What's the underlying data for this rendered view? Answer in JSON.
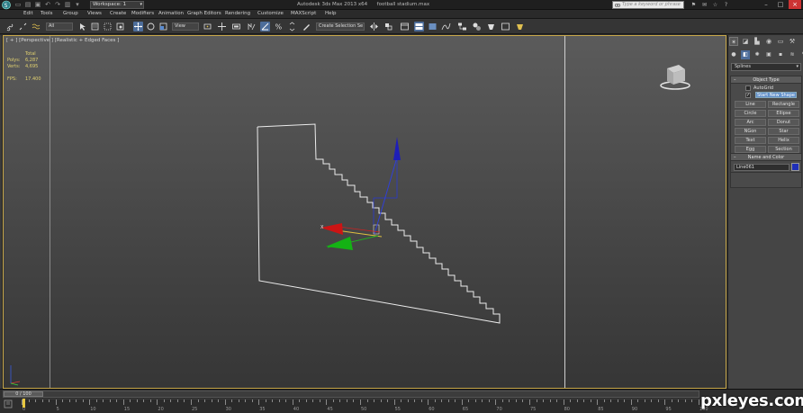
{
  "titlebar": {
    "workspace": "Workspace: 1",
    "title": "Autodesk 3ds Max 2013 x64      football stadium.max",
    "search_placeholder": "Type a keyword or phrase"
  },
  "menu": [
    "Edit",
    "Tools",
    "Group",
    "Views",
    "Create",
    "Modifiers",
    "Animation",
    "Graph Editors",
    "Rendering",
    "Customize",
    "MAXScript",
    "Help"
  ],
  "toolbar": {
    "filter": "All",
    "ref_coord": "View",
    "selection_set": "Create Selection Se"
  },
  "viewport": {
    "label": "[ + ] [Perspective ] [Realistic + Edged Faces ]",
    "stats": {
      "header": "Total",
      "polys_label": "Polys:",
      "polys_value": "6,287",
      "verts_label": "Verts:",
      "verts_value": "4,695",
      "fps_label": "FPS:",
      "fps_value": "17.400"
    },
    "gizmo_axis_label": "X"
  },
  "command_panel": {
    "category": "Splines",
    "object_type_title": "Object Type",
    "autogrid_label": "AutoGrid",
    "autogrid_checked": false,
    "start_new_shape_checked": true,
    "start_new_shape_label": "Start New Shape",
    "shapes": [
      [
        "Line",
        "Rectangle"
      ],
      [
        "Circle",
        "Ellipse"
      ],
      [
        "Arc",
        "Donut"
      ],
      [
        "NGon",
        "Star"
      ],
      [
        "Text",
        "Helix"
      ],
      [
        "Egg",
        "Section"
      ]
    ],
    "name_color_title": "Name and Color",
    "object_name": "Line061",
    "object_color": "#1f2fb8"
  },
  "timeline": {
    "slider_label": "0 / 100",
    "ticks": [
      0,
      5,
      10,
      15,
      20,
      25,
      30,
      35,
      40,
      45,
      50,
      55,
      60,
      65,
      70,
      75,
      80,
      85,
      90,
      95,
      100
    ]
  },
  "watermark": "pxleyes.com"
}
